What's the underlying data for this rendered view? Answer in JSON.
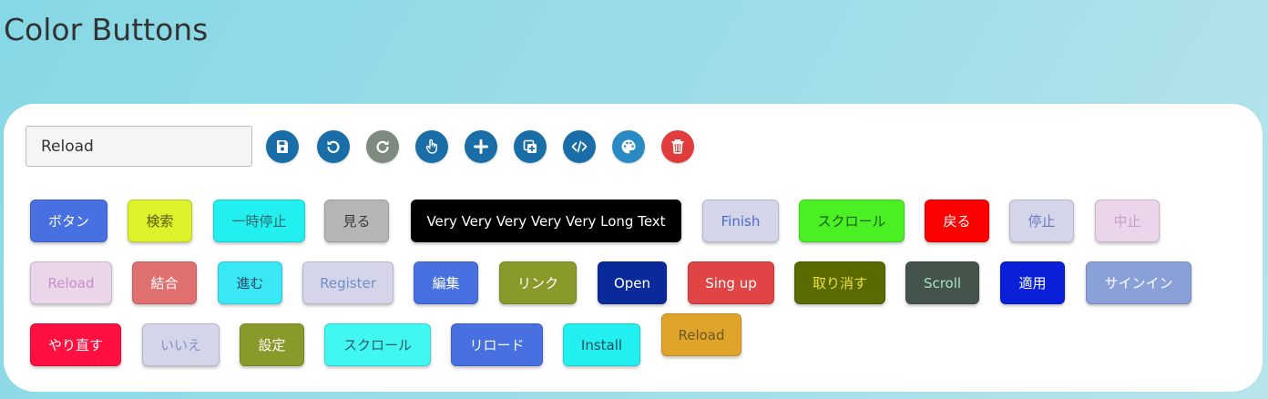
{
  "page": {
    "title": "Color Buttons"
  },
  "toolbar": {
    "input_value": "Reload",
    "icons": [
      {
        "name": "save-icon",
        "color": "#1a6ea8"
      },
      {
        "name": "rotate-left-icon",
        "color": "#1a6ea8"
      },
      {
        "name": "rotate-right-icon",
        "color": "#7d8a80"
      },
      {
        "name": "hand-pointer-icon",
        "color": "#1a6ea8"
      },
      {
        "name": "plus-icon",
        "color": "#1a6ea8"
      },
      {
        "name": "copy-plus-icon",
        "color": "#1a6ea8"
      },
      {
        "name": "code-icon",
        "color": "#1a6ea8"
      },
      {
        "name": "palette-icon",
        "color": "#2a8ac4"
      },
      {
        "name": "trash-icon",
        "color": "#e03c3c"
      }
    ]
  },
  "buttons": [
    {
      "label": "ボタン",
      "bg": "#4870e0",
      "color": "#ffffff"
    },
    {
      "label": "検索",
      "bg": "#ddf22a",
      "color": "#5a5a10"
    },
    {
      "label": "一時停止",
      "bg": "#22f0f0",
      "color": "#2a6a6a"
    },
    {
      "label": "見る",
      "bg": "#b5b5b5",
      "color": "#3a3a3a"
    },
    {
      "label": "Very Very Very Very Very Long Text",
      "bg": "#000000",
      "color": "#ffffff"
    },
    {
      "label": "Finish",
      "bg": "#d5d5ea",
      "color": "#4a6ac8"
    },
    {
      "label": "スクロール",
      "bg": "#4af022",
      "color": "#1a5a1a"
    },
    {
      "label": "戻る",
      "bg": "#ff0000",
      "color": "#ffffff"
    },
    {
      "label": "停止",
      "bg": "#d5d5ea",
      "color": "#6a7ac0"
    },
    {
      "label": "中止",
      "bg": "#ead5ea",
      "color": "#c8a0c8"
    },
    {
      "label": "Reload",
      "bg": "#ead5ea",
      "color": "#c890c8"
    },
    {
      "label": "結合",
      "bg": "#e07070",
      "color": "#ffffff"
    },
    {
      "label": "進む",
      "bg": "#3ae8f5",
      "color": "#2a4a6a"
    },
    {
      "label": "Register",
      "bg": "#d5d5ea",
      "color": "#7090c8"
    },
    {
      "label": "編集",
      "bg": "#4870e0",
      "color": "#ffffff"
    },
    {
      "label": "リンク",
      "bg": "#8a9a2a",
      "color": "#ffffff"
    },
    {
      "label": "Open",
      "bg": "#0a2a9a",
      "color": "#ffffff"
    },
    {
      "label": "Sing up",
      "bg": "#e04444",
      "color": "#ffffff"
    },
    {
      "label": "取り消す",
      "bg": "#5a6a00",
      "color": "#e8e040"
    },
    {
      "label": "Scroll",
      "bg": "#44544a",
      "color": "#a8e0c8"
    },
    {
      "label": "適用",
      "bg": "#0a20d8",
      "color": "#ffffff"
    },
    {
      "label": "サインイン",
      "bg": "#8aa0d8",
      "color": "#ffffff"
    },
    {
      "label": "やり直す",
      "bg": "#ff1040",
      "color": "#ffffff"
    },
    {
      "label": "いいえ",
      "bg": "#d5d5ea",
      "color": "#8a90c8"
    },
    {
      "label": "設定",
      "bg": "#8a9a2a",
      "color": "#ffffff"
    },
    {
      "label": "スクロール",
      "bg": "#40f8f0",
      "color": "#2a5a6a"
    },
    {
      "label": "リロード",
      "bg": "#4870e0",
      "color": "#ffffff"
    },
    {
      "label": "Install",
      "bg": "#22f0f0",
      "color": "#1a4a5a"
    },
    {
      "label": "Reload",
      "bg": "#e0a42a",
      "color": "#6a5a20"
    }
  ]
}
